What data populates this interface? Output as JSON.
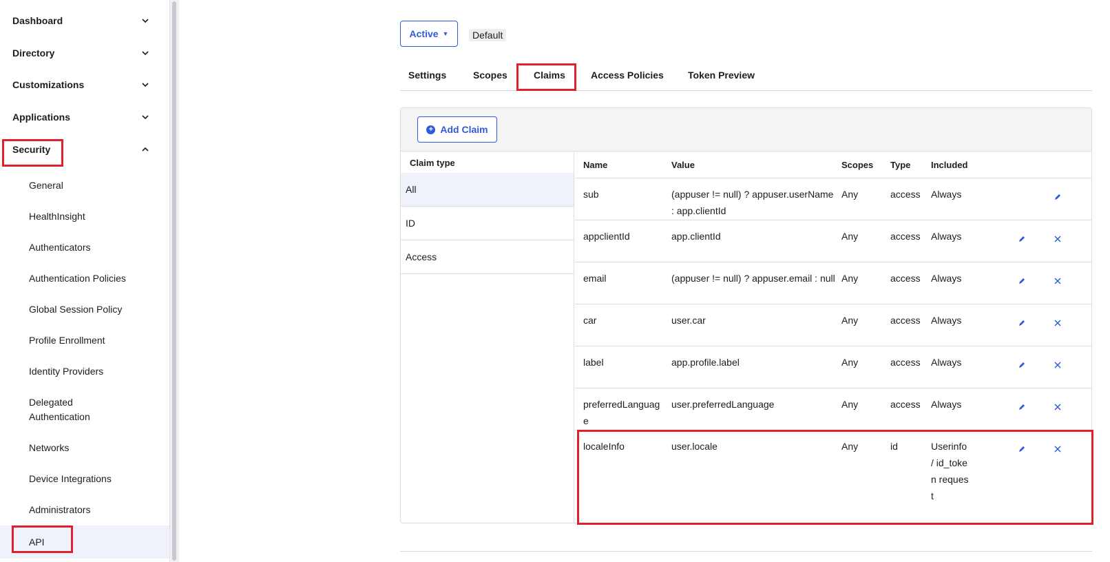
{
  "sidebar": {
    "sections": [
      {
        "label": "Dashboard",
        "expanded": false
      },
      {
        "label": "Directory",
        "expanded": false
      },
      {
        "label": "Customizations",
        "expanded": false
      },
      {
        "label": "Applications",
        "expanded": false
      },
      {
        "label": "Security",
        "expanded": true
      }
    ],
    "security_items": [
      {
        "label": "General"
      },
      {
        "label": "HealthInsight"
      },
      {
        "label": "Authenticators"
      },
      {
        "label": "Authentication Policies"
      },
      {
        "label": "Global Session Policy"
      },
      {
        "label": "Profile Enrollment"
      },
      {
        "label": "Identity Providers"
      },
      {
        "label": "Delegated\nAuthentication"
      },
      {
        "label": "Networks"
      },
      {
        "label": "Device Integrations"
      },
      {
        "label": "Administrators"
      },
      {
        "label": "API"
      }
    ],
    "active_item": "API"
  },
  "header": {
    "status_label": "Active",
    "status_caret": "▼",
    "default_badge": "Default"
  },
  "tabs": [
    {
      "label": "Settings"
    },
    {
      "label": "Scopes"
    },
    {
      "label": "Claims"
    },
    {
      "label": "Access Policies"
    },
    {
      "label": "Token Preview"
    }
  ],
  "active_tab": "Claims",
  "panel": {
    "add_button_label": "Add Claim",
    "add_button_icon": "plus-circle-icon",
    "claim_type_header": "Claim type",
    "claim_types": [
      {
        "label": "All"
      },
      {
        "label": "ID"
      },
      {
        "label": "Access"
      }
    ],
    "selected_claim_type": "All",
    "columns": {
      "name": "Name",
      "value": "Value",
      "scopes": "Scopes",
      "type": "Type",
      "included": "Included"
    },
    "rows": [
      {
        "name": "sub",
        "value": "(appuser != null) ? appuser.userName : app.clientId",
        "scopes": "Any",
        "type": "access",
        "included": "Always",
        "editable": true,
        "deletable": false
      },
      {
        "name": "appclientId",
        "value": "app.clientId",
        "scopes": "Any",
        "type": "access",
        "included": "Always",
        "editable": true,
        "deletable": true
      },
      {
        "name": "email",
        "value": "(appuser != null) ? appuser.email : null",
        "scopes": "Any",
        "type": "access",
        "included": "Always",
        "editable": true,
        "deletable": true
      },
      {
        "name": "car",
        "value": "user.car",
        "scopes": "Any",
        "type": "access",
        "included": "Always",
        "editable": true,
        "deletable": true
      },
      {
        "name": "label",
        "value": "app.profile.label",
        "scopes": "Any",
        "type": "access",
        "included": "Always",
        "editable": true,
        "deletable": true
      },
      {
        "name": "preferredLanguage",
        "value": "user.preferredLanguage",
        "scopes": "Any",
        "type": "access",
        "included": "Always",
        "editable": true,
        "deletable": true
      },
      {
        "name": "localeInfo",
        "value": "user.locale",
        "scopes": "Any",
        "type": "id",
        "included": "Userinfo / id_token request",
        "editable": true,
        "deletable": true
      }
    ]
  },
  "colors": {
    "accent": "#2d5bd9",
    "highlight": "#e0202a",
    "selected_bg": "#f0f2fb"
  }
}
